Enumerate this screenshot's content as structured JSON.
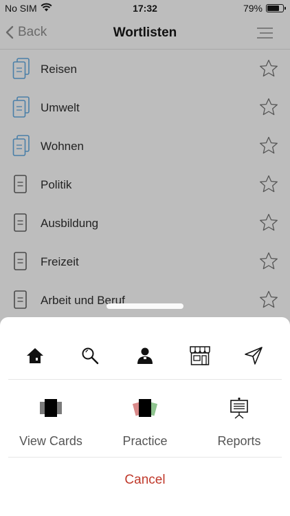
{
  "status": {
    "carrier": "No SIM",
    "time": "17:32",
    "battery_percent": "79%",
    "battery_level": 0.79
  },
  "nav": {
    "back_label": "Back",
    "title": "Wortlisten"
  },
  "word_lists": [
    {
      "label": "Reisen",
      "icon": "multi-document-icon",
      "accent": true
    },
    {
      "label": "Umwelt",
      "icon": "multi-document-icon",
      "accent": true
    },
    {
      "label": "Wohnen",
      "icon": "multi-document-icon",
      "accent": true
    },
    {
      "label": "Politik",
      "icon": "document-icon",
      "accent": false
    },
    {
      "label": "Ausbildung",
      "icon": "document-icon",
      "accent": false
    },
    {
      "label": "Freizeit",
      "icon": "document-icon",
      "accent": false
    },
    {
      "label": "Arbeit und Beruf",
      "icon": "document-icon",
      "accent": false
    }
  ],
  "sheet": {
    "tab_icons": [
      "home-icon",
      "search-icon",
      "user-icon",
      "store-icon",
      "send-icon"
    ],
    "actions": [
      {
        "label": "View Cards",
        "icon": "cards-icon"
      },
      {
        "label": "Practice",
        "icon": "practice-icon"
      },
      {
        "label": "Reports",
        "icon": "reports-icon"
      }
    ],
    "cancel_label": "Cancel"
  },
  "colors": {
    "overlay_background": "#bdbdbd",
    "accent_icon": "#4a7fa8",
    "cancel": "#c0392b"
  }
}
